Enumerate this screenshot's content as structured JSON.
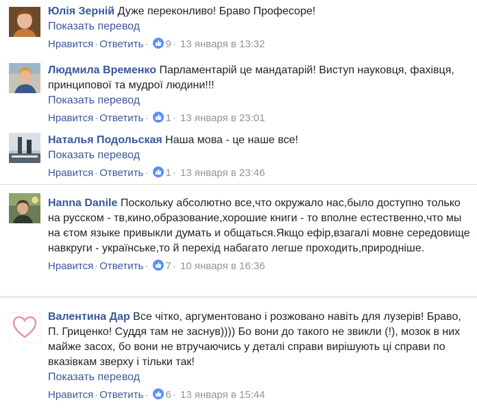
{
  "comments": [
    {
      "author": "Юлія Зерній",
      "text": "Дуже переконливо! Браво Професоре!",
      "translate": "Показать перевод",
      "like": "Нравится",
      "reply": "Ответить",
      "likes": "9",
      "time": "13 января в 13:32"
    },
    {
      "author": "Людмила Временко",
      "text": "Парламентарій це мандатарій! Виступ науковця, фахівця, принципової та мудрої людини!!!",
      "translate": "Показать перевод",
      "like": "Нравится",
      "reply": "Ответить",
      "likes": "1",
      "time": "13 января в 23:01"
    },
    {
      "author": "Наталья Подольская",
      "text": "Наша мова - це наше все!",
      "translate": "Показать перевод",
      "like": "Нравится",
      "reply": "Ответить",
      "likes": "1",
      "time": "13 января в 23:46"
    },
    {
      "author": "Hanna Danile",
      "text": "Поскольку абсолютно все,что окружало нас,было доступно только на русском - тв,кино,образование,хорошие книги - то вполне естественно,что мы на єтом языке привыкли думать и общаться.Якщо ефір,взагалі мовне середовище навкруги - українське,то й перехід набагато легше проходить,природніше.",
      "translate": "",
      "like": "Нравится",
      "reply": "Ответить",
      "likes": "7",
      "time": "10 января в 16:36"
    },
    {
      "author": "Валентина Дар",
      "text": "Все чітко, аргументовано і розжовано навіть для лузерів! Браво, П. Гриценко! Суддя там не заснув)))) Бо вони до такого не звикли (!), мозок в них майже засох, бо вони не втручаючись у деталі справи вирішують ці справи по вказівкам зверху і тільки так!",
      "translate": "Показать перевод",
      "like": "Нравится",
      "reply": "Ответить",
      "likes": "6",
      "time": "13 января в 15:44"
    }
  ],
  "colors": {
    "link": "#385898",
    "meta": "#90949c",
    "like_icon": "#5890ff"
  },
  "icons": {
    "like": "thumbs-up-icon"
  }
}
